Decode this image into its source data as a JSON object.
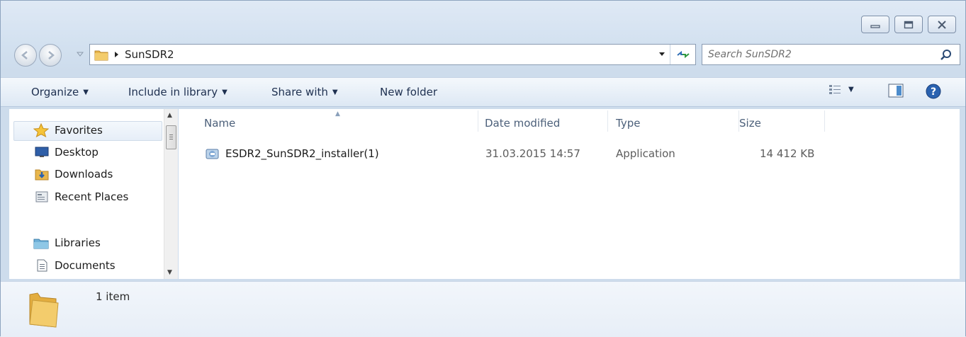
{
  "window": {
    "controls": [
      "minimize",
      "maximize",
      "close"
    ]
  },
  "address_bar": {
    "path": "SunSDR2",
    "search_placeholder": "Search SunSDR2"
  },
  "toolbar": {
    "organize": "Organize",
    "include_in_library": "Include in library",
    "share_with": "Share with",
    "new_folder": "New folder"
  },
  "navigation": {
    "favorites_label": "Favorites",
    "favorites": [
      {
        "label": "Desktop",
        "icon": "desktop-icon"
      },
      {
        "label": "Downloads",
        "icon": "downloads-icon"
      },
      {
        "label": "Recent Places",
        "icon": "recent-places-icon"
      }
    ],
    "libraries_label": "Libraries",
    "libraries": [
      {
        "label": "Documents",
        "icon": "documents-icon"
      }
    ]
  },
  "file_list": {
    "columns": [
      "Name",
      "Date modified",
      "Type",
      "Size"
    ],
    "rows": [
      {
        "name": "ESDR2_SunSDR2_installer(1)",
        "date_modified": "31.03.2015 14:57",
        "type": "Application",
        "size": "14 412 KB"
      }
    ]
  },
  "details_pane": {
    "item_count": "1 item"
  },
  "colors": {
    "accent": "#1e3050",
    "window_frame": "#dbe6f2",
    "folder": "#e8b64c"
  }
}
